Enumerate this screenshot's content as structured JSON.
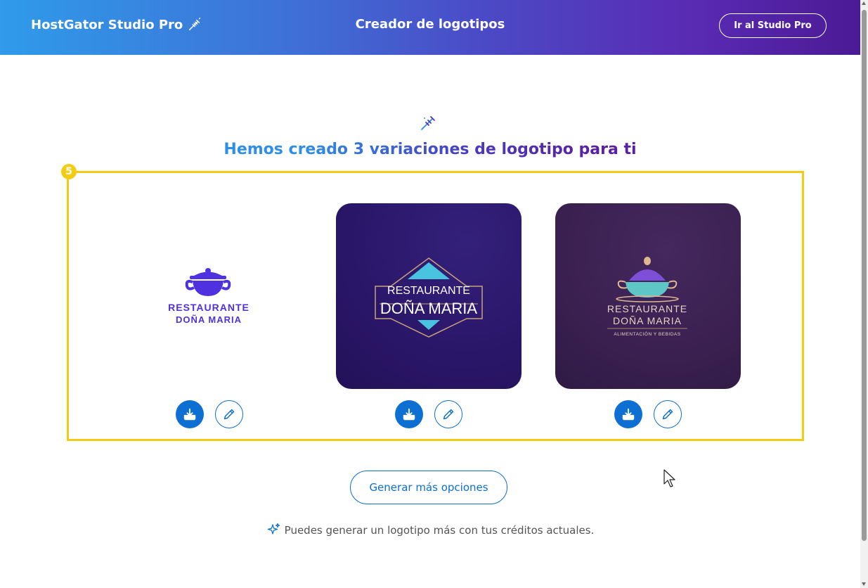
{
  "header": {
    "brand": "HostGator Studio Pro",
    "title": "Creador de logotipos",
    "studio_button": "Ir al Studio Pro"
  },
  "main": {
    "headline": "Hemos creado 3 variaciones de logotipo para ti",
    "highlight_badge": "5",
    "logos": [
      {
        "line1": "RESTAURANTE",
        "line2": "DOÑA MARIA",
        "tagline": ""
      },
      {
        "line1": "RESTAURANTE",
        "line2": "DOÑA MARIA",
        "tagline": ""
      },
      {
        "line1": "RESTAURANTE",
        "line2": "DOÑA MARIA",
        "tagline": "ALIMENTACIÓN Y BEBIDAS"
      }
    ],
    "generate_button": "Generar más opciones",
    "credits_note": "Puedes generar un logotipo más con tus créditos actuales."
  },
  "colors": {
    "accent": "#0c6fd1",
    "highlight": "#f2cd14",
    "header_start": "#2f9be9",
    "header_end": "#4b1a95"
  }
}
